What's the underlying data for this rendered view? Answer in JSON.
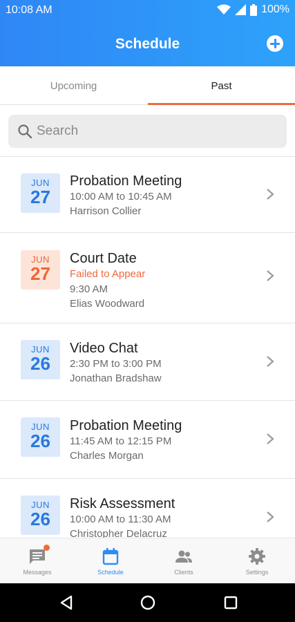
{
  "status_bar": {
    "time": "10:08 AM",
    "battery": "100%"
  },
  "header": {
    "title": "Schedule"
  },
  "tabs": [
    {
      "label": "Upcoming",
      "active": false
    },
    {
      "label": "Past",
      "active": true
    }
  ],
  "search": {
    "placeholder": "Search",
    "value": ""
  },
  "appointments": [
    {
      "month": "JUN",
      "day": "27",
      "title": "Probation Meeting",
      "status": "",
      "time": "10:00 AM to 10:45 AM",
      "person": "Harrison Collier",
      "color": "blue"
    },
    {
      "month": "JUN",
      "day": "27",
      "title": "Court Date",
      "status": "Failed to Appear",
      "time": "9:30 AM",
      "person": "Elias Woodward",
      "color": "orange"
    },
    {
      "month": "JUN",
      "day": "26",
      "title": "Video Chat",
      "status": "",
      "time": "2:30 PM to 3:00 PM",
      "person": "Jonathan Bradshaw",
      "color": "blue"
    },
    {
      "month": "JUN",
      "day": "26",
      "title": "Probation Meeting",
      "status": "",
      "time": "11:45 AM to 12:15 PM",
      "person": "Charles Morgan",
      "color": "blue"
    },
    {
      "month": "JUN",
      "day": "26",
      "title": "Risk Assessment",
      "status": "",
      "time": "10:00 AM to 11:30 AM",
      "person": "Christopher Delacruz",
      "color": "blue"
    }
  ],
  "bottom_nav": [
    {
      "label": "Messages",
      "icon": "messages-icon",
      "active": false,
      "has_badge": true
    },
    {
      "label": "Schedule",
      "icon": "calendar-icon",
      "active": true,
      "has_badge": false
    },
    {
      "label": "Clients",
      "icon": "clients-icon",
      "active": false,
      "has_badge": false
    },
    {
      "label": "Settings",
      "icon": "gear-icon",
      "active": false,
      "has_badge": false
    }
  ],
  "colors": {
    "header_start": "#2f87f5",
    "header_end": "#2ea2fb",
    "tab_indicator": "#ef6a3f",
    "blue_accent": "#2a78dc",
    "orange_accent": "#ec6734",
    "nav_active": "#2d8cf5"
  }
}
